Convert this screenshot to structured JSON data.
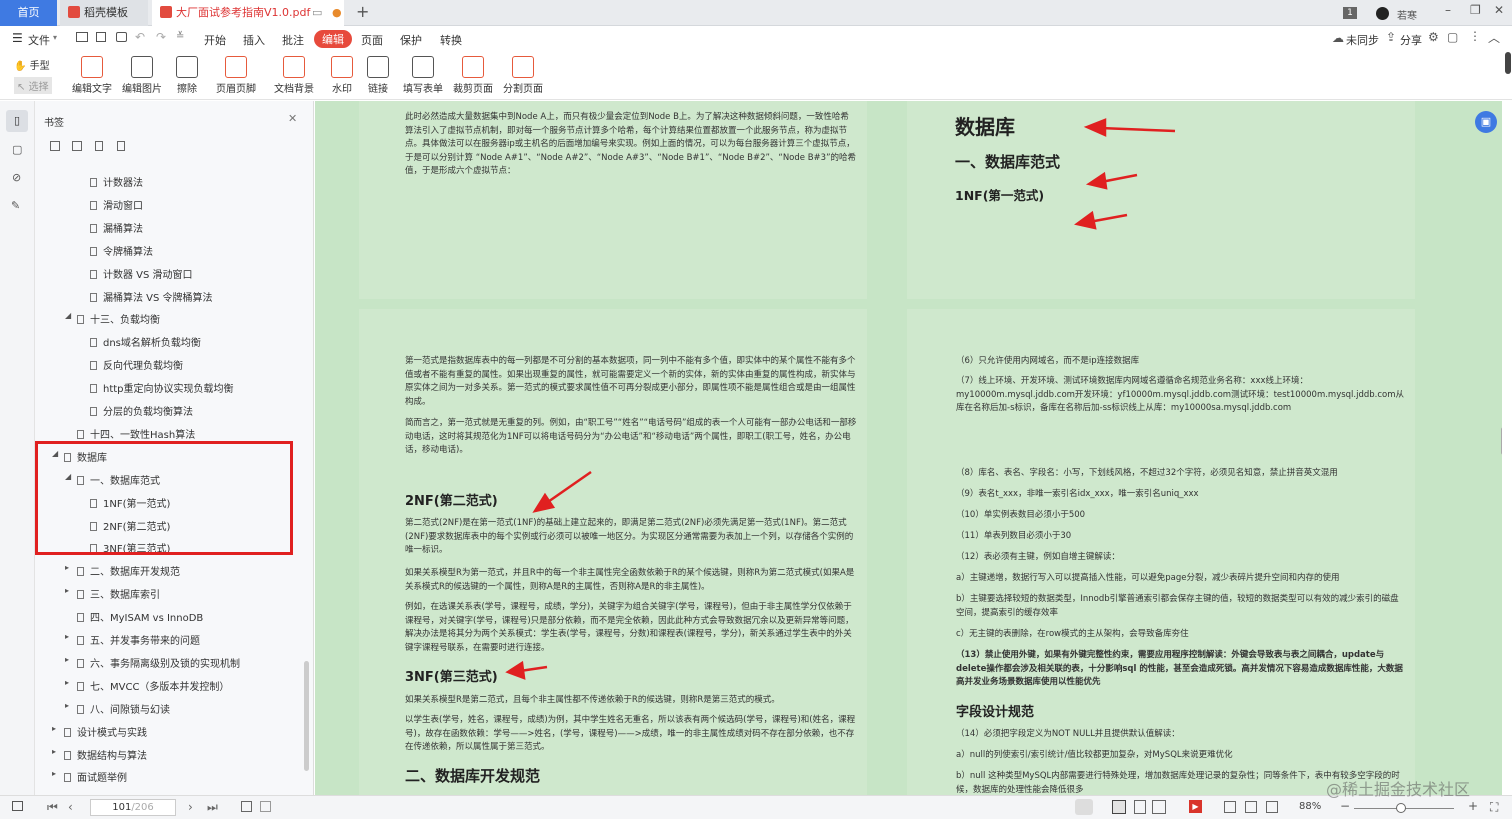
{
  "tabs": {
    "home": "首页",
    "docer": "稻壳模板",
    "pdf": "大厂面试参考指南V1.0.pdf",
    "count_badge": "1",
    "user": "若寒"
  },
  "menu": {
    "file": "文件",
    "items": [
      "开始",
      "插入",
      "批注",
      "编辑",
      "页面",
      "保护",
      "转换"
    ],
    "sync": "未同步",
    "share": "分享"
  },
  "ribbon": {
    "hand": "手型",
    "select": "选择",
    "tools": [
      "编辑文字",
      "编辑图片",
      "擦除",
      "页眉页脚",
      "文档背景",
      "水印",
      "链接",
      "填写表单",
      "裁剪页面",
      "分割页面"
    ]
  },
  "panel": {
    "title": "书签",
    "items": [
      {
        "text": "计数器法",
        "level": 3
      },
      {
        "text": "滑动窗口",
        "level": 3
      },
      {
        "text": "漏桶算法",
        "level": 3
      },
      {
        "text": "令牌桶算法",
        "level": 3
      },
      {
        "text": "计数器 VS 滑动窗口",
        "level": 3
      },
      {
        "text": "漏桶算法 VS 令牌桶算法",
        "level": 3
      },
      {
        "text": "十三、负载均衡",
        "level": 2,
        "arrow": "▲"
      },
      {
        "text": "dns域名解析负载均衡",
        "level": 3
      },
      {
        "text": "反向代理负载均衡",
        "level": 3
      },
      {
        "text": "http重定向协议实现负载均衡",
        "level": 3
      },
      {
        "text": "分层的负载均衡算法",
        "level": 3
      },
      {
        "text": "十四、一致性Hash算法",
        "level": 2
      },
      {
        "text": "数据库",
        "level": 1,
        "arrow": "▲"
      },
      {
        "text": "一、数据库范式",
        "level": 2,
        "arrow": "▲",
        "selected": true
      },
      {
        "text": "1NF(第一范式)",
        "level": 3
      },
      {
        "text": "2NF(第二范式)",
        "level": 3
      },
      {
        "text": "3NF(第三范式)",
        "level": 3
      },
      {
        "text": "二、数据库开发规范",
        "level": 2,
        "arrow": "▶"
      },
      {
        "text": "三、数据库索引",
        "level": 2,
        "arrow": "▶"
      },
      {
        "text": "四、MyISAM vs InnoDB",
        "level": 2
      },
      {
        "text": "五、并发事务带来的问题",
        "level": 2,
        "arrow": "▶"
      },
      {
        "text": "六、事务隔离级别及锁的实现机制",
        "level": 2,
        "arrow": "▶"
      },
      {
        "text": "七、MVCC（多版本并发控制）",
        "level": 2,
        "arrow": "▶"
      },
      {
        "text": "八、间隙锁与幻读",
        "level": 2,
        "arrow": "▶"
      },
      {
        "text": "设计模式与实践",
        "level": 1,
        "arrow": "▶"
      },
      {
        "text": "数据结构与算法",
        "level": 1,
        "arrow": "▶"
      },
      {
        "text": "面试题举例",
        "level": 1,
        "arrow": "▶"
      }
    ]
  },
  "page_left_top": {
    "p1": "此时必然造成大量数据集中到Node A上，而只有极少量会定位到Node B上。为了解决这种数据倾斜问题，一致性哈希算法引入了虚拟节点机制，即对每一个服务节点计算多个哈希，每个计算结果位置都放置一个此服务节点，称为虚拟节点。具体做法可以在服务器ip或主机名的后面增加编号来实现。例如上面的情况，可以为每台服务器计算三个虚拟节点，于是可以分别计算 “Node A#1”、“Node A#2”、“Node A#3”、“Node B#1”、“Node B#2”、“Node B#3”的哈希值，于是形成六个虚拟节点："
  },
  "page_right_top": {
    "title": "数据库",
    "h1": "一、数据库范式",
    "h2": "1NF(第一范式)"
  },
  "page_left_bottom": {
    "p1": "第一范式是指数据库表中的每一列都是不可分割的基本数据项，同一列中不能有多个值，即实体中的某个属性不能有多个值或者不能有重复的属性。如果出现重复的属性，就可能需要定义一个新的实体，新的实体由重复的属性构成，新实体与原实体之间为一对多关系。第一范式的模式要求属性值不可再分裂成更小部分，即属性项不能是属性组合或是由一组属性构成。",
    "p2": "简而言之，第一范式就是无重复的列。例如，由“职工号”“姓名”“电话号码”组成的表一个人可能有一部办公电话和一部移动电话，这时将其规范化为1NF可以将电话号码分为“办公电话”和“移动电话”两个属性，即职工(职工号，姓名，办公电话，移动电话)。",
    "h_2nf": "2NF(第二范式)",
    "p3": "第二范式(2NF)是在第一范式(1NF)的基础上建立起来的，即满足第二范式(2NF)必须先满足第一范式(1NF)。第二范式(2NF)要求数据库表中的每个实例或行必须可以被唯一地区分。为实现区分通常需要为表加上一个列，以存储各个实例的唯一标识。",
    "p4": "如果关系模型R为第一范式，并且R中的每一个非主属性完全函数依赖于R的某个候选键，则称R为第二范式模式(如果A是关系模式R的候选键的一个属性，则称A是R的主属性，否则称A是R的非主属性)。",
    "p5": "例如，在选课关系表(学号，课程号，成绩，学分)，关键字为组合关键字(学号，课程号)，但由于非主属性学分仅依赖于课程号，对关键字(学号，课程号)只是部分依赖，而不是完全依赖，因此此种方式会导致数据冗余以及更新异常等问题，解决办法是将其分为两个关系模式：学生表(学号，课程号，分数)和课程表(课程号，学分)，新关系通过学生表中的外关键字课程号联系，在需要时进行连接。",
    "h_3nf": "3NF(第三范式)",
    "p6": "如果关系模型R是第二范式，且每个非主属性都不传递依赖于R的候选键，则称R是第三范式的模式。",
    "p7": "以学生表(学号，姓名，课程号，成绩)为例，其中学生姓名无重名，所以该表有两个候选码(学号，课程号)和(姓名，课程号)，故存在函数依赖：学号——>姓名，(学号，课程号)——>成绩，唯一的非主属性成绩对码不存在部分依赖，也不存在传递依赖，所以属性属于第三范式。",
    "h_dev": "二、数据库开发规范"
  },
  "page_right_bottom": {
    "r6": "（6）只允许使用内网域名，而不是ip连接数据库",
    "r7": "（7）线上环境、开发环境、测试环境数据库内网域名遵循命名规范业务名称：xxx线上环境：my10000m.mysql.jddb.com开发环境：yf10000m.mysql.jddb.com测试环境：test10000m.mysql.jddb.com从库在名称后加-s标识，备库在名称后加-ss标识线上从库：my10000sa.mysql.jddb.com",
    "r8": "（8）库名、表名、字段名：小写，下划线风格，不超过32个字符，必须见名知意，禁止拼音英文混用",
    "r9": "（9）表名t_xxx，非唯一索引名idx_xxx，唯一索引名uniq_xxx",
    "r10": "（10）单实例表数目必须小于500",
    "r11": "（11）单表列数目必须小于30",
    "r12": "（12）表必须有主键，例如自增主键解读：",
    "ra": "a）主键递增，数据行写入可以提高插入性能，可以避免page分裂，减少表碎片提升空间和内存的使用",
    "rb": "b）主键要选择较短的数据类型，Innodb引擎普通索引都会保存主键的值，较短的数据类型可以有效的减少索引的磁盘空间，提高索引的缓存效率",
    "rc": "c）无主键的表删除，在row模式的主从架构，会导致备库夯住",
    "r13": "（13）禁止使用外键，如果有外键完整性约束，需要应用程序控制解读：外键会导致表与表之间耦合，update与delete操作都会涉及相关联的表，十分影响sql 的性能，甚至会造成死锁。高并发情况下容易造成数据库性能，大数据高并发业务场景数据库使用以性能优先",
    "h_field": "字段设计规范",
    "r14": "（14）必须把字段定义为NOT NULL并且提供默认值解读：",
    "r14a": "a）null的列使索引/索引统计/值比较都更加复杂，对MySQL来说更难优化",
    "r14b": "b）null 这种类型MySQL内部需要进行特殊处理，增加数据库处理记录的复杂性；同等条件下，表中有较多空字段的时候，数据库的处理性能会降低很多"
  },
  "status": {
    "page_current": "101",
    "page_total": "/206",
    "zoom": "88%",
    "watermark": "@稀土掘金技术社区"
  },
  "colors": {
    "accent": "#3f7ae2",
    "edit_tab": "#e74a3c",
    "highlight_box": "#e02020",
    "doc_bg": "#c7e5c6"
  }
}
